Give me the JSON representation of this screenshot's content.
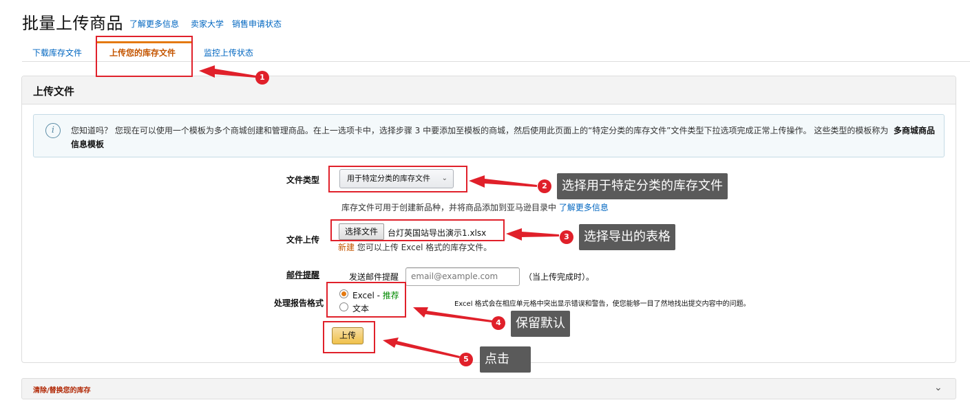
{
  "header": {
    "title": "批量上传商品",
    "links": [
      "了解更多信息",
      "卖家大学",
      "销售申请状态"
    ]
  },
  "tabs": [
    {
      "label": "下载库存文件"
    },
    {
      "label": "上传您的库存文件"
    },
    {
      "label": "监控上传状态"
    }
  ],
  "panel": {
    "title": "上传文件",
    "info_icon": "i",
    "info_text": "您知道吗？ 您现在可以使用一个模板为多个商城创建和管理商品。在上一选项卡中，选择步骤 3 中要添加至模板的商城，然后使用此页面上的“特定分类的库存文件”文件类型下拉选项完成正常上传操作。 这些类型的模板称为",
    "info_bold": "多商城商品信息模板"
  },
  "form": {
    "file_type_label": "文件类型",
    "file_type_value": "用于特定分类的库存文件",
    "file_type_help": "库存文件可用于创建新品种，并将商品添加到亚马逊目录中",
    "file_type_help_link": "了解更多信息",
    "file_upload_label": "文件上传",
    "choose_file_button": "选择文件",
    "file_name": "台灯英国站导出演示1.xlsx",
    "upload_note_new": "新建",
    "upload_note": "您可以上传 Excel 格式的库存文件。",
    "email_label": "邮件提醒",
    "email_send_label": "发送邮件提醒",
    "email_placeholder": "email@example.com",
    "email_suffix": "（当上传完成时）。",
    "report_format_label": "处理报告格式",
    "report_options": [
      {
        "label": "Excel",
        "tag": "推荐",
        "checked": true
      },
      {
        "label": "文本",
        "checked": false
      }
    ],
    "report_option_sep": " - ",
    "report_format_desc": "Excel 格式会在相应单元格中突出显示错误和警告，使您能够一目了然地找出提交内容中的问题。",
    "upload_button": "上传"
  },
  "collapsible": {
    "label": "清除/替换您的库存"
  },
  "annotations": {
    "color": "#e0202a",
    "callout_bg": "#5a5a5a",
    "steps": [
      {
        "num": "1"
      },
      {
        "num": "2",
        "text": "选择用于特定分类的库存文件"
      },
      {
        "num": "3",
        "text": "选择导出的表格"
      },
      {
        "num": "4",
        "text": "保留默认"
      },
      {
        "num": "5",
        "text": "点击"
      }
    ]
  }
}
